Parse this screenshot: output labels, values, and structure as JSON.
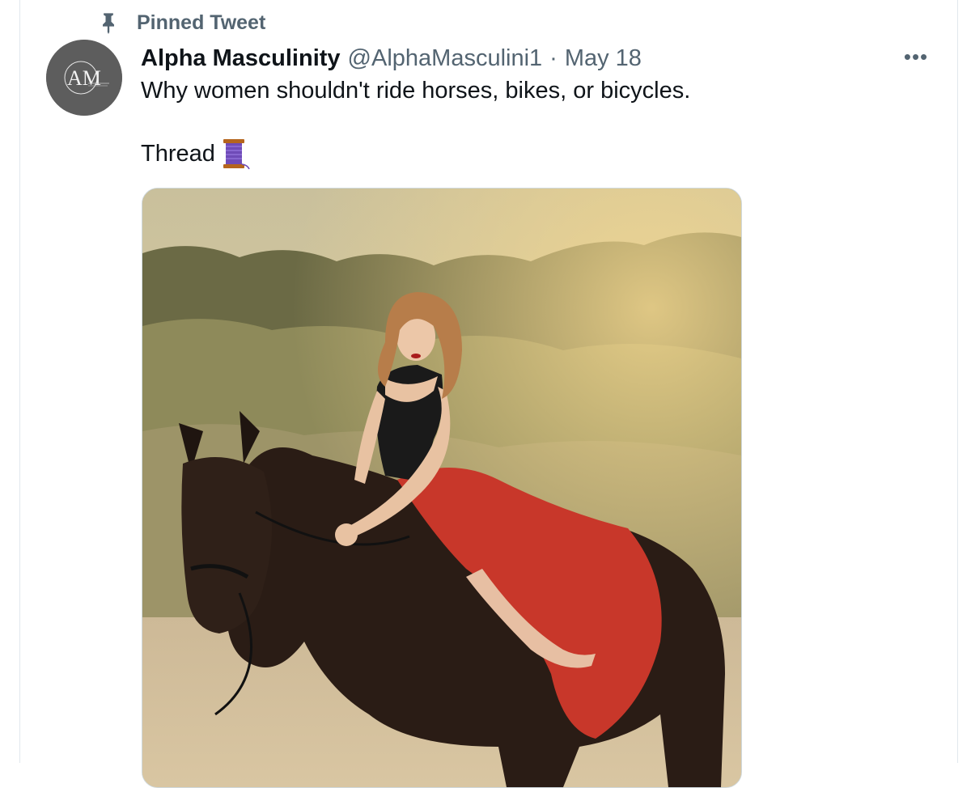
{
  "pinned": {
    "label": "Pinned Tweet",
    "icon": "pin-icon"
  },
  "tweet": {
    "display_name": "Alpha Masculinity",
    "handle": "@AlphaMasculini1",
    "separator": "·",
    "date": "May 18",
    "text": "Why women shouldn't ride horses, bikes, or bicycles.",
    "thread_label": "Thread",
    "thread_icon": "spool-of-thread-icon",
    "more_label": "•••",
    "more_icon": "more-options-icon"
  },
  "avatar": {
    "initials": "AM",
    "bg_color": "#5d5d5d"
  },
  "media": {
    "description_icon": "photo-woman-on-horse"
  },
  "colors": {
    "text_primary": "#0f1419",
    "text_secondary": "#536471",
    "border": "#cfd9de"
  }
}
